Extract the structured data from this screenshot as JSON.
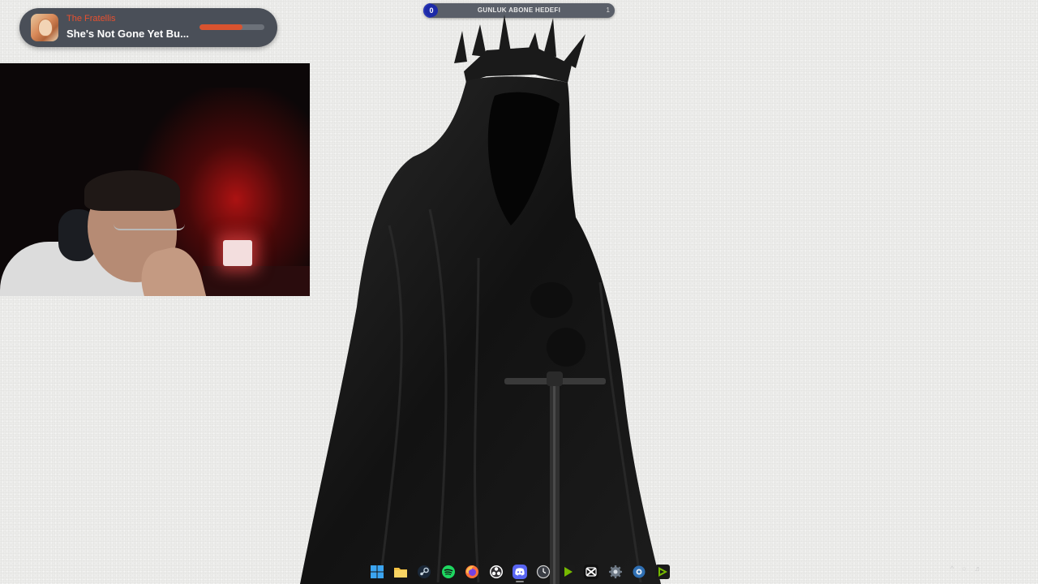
{
  "goal": {
    "current": "0",
    "label": "GUNLUK ABONE HEDEFI",
    "target": "1",
    "progress": 0.06
  },
  "now_playing": {
    "artist": "The Fratellis",
    "title": "She's Not Gone Yet Bu...",
    "progress": 0.66
  },
  "taskbar": {
    "items": [
      {
        "icon": "windows-start-icon",
        "active": false
      },
      {
        "icon": "file-explorer-icon",
        "active": false
      },
      {
        "icon": "steam-icon",
        "active": false
      },
      {
        "icon": "spotify-icon",
        "active": false
      },
      {
        "icon": "firefox-icon",
        "active": false
      },
      {
        "icon": "obs-icon",
        "active": false
      },
      {
        "icon": "discord-icon",
        "active": true
      },
      {
        "icon": "clock-app-icon",
        "active": false
      },
      {
        "icon": "nvidia-icon",
        "active": false
      },
      {
        "icon": "capcut-icon",
        "active": false
      },
      {
        "icon": "settings-gear-icon",
        "active": false
      },
      {
        "icon": "steelseries-icon",
        "active": false
      },
      {
        "icon": "nvidia-geforce-icon",
        "active": false
      }
    ]
  },
  "colors": {
    "desktop_bg": "#ececea",
    "goal_fill": "#2a36b8",
    "artist_text": "#e8502f",
    "progress_fill": "#d9532f"
  }
}
